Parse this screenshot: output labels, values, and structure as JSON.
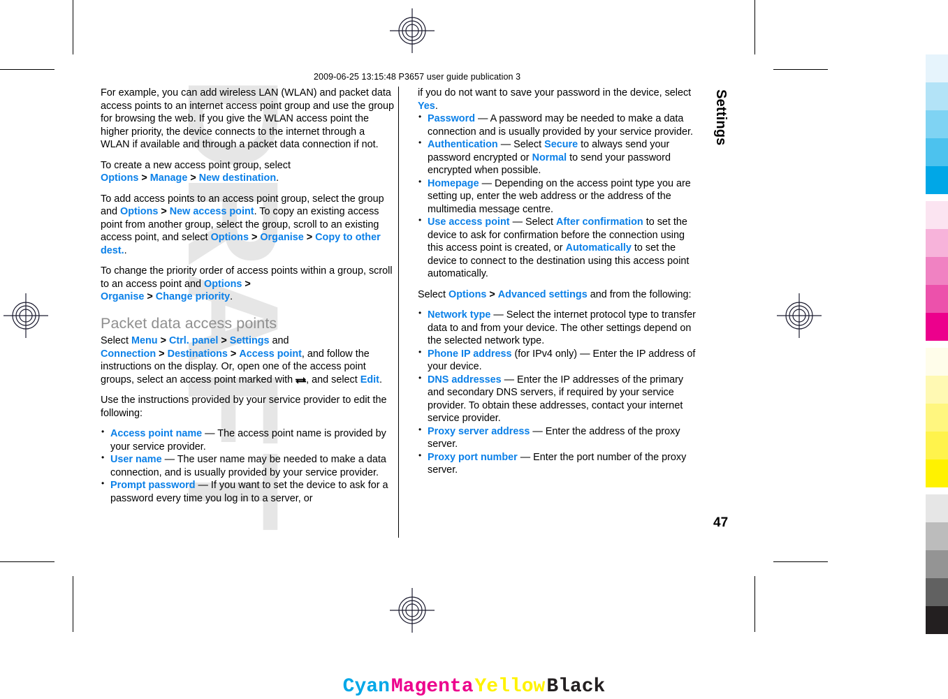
{
  "document": {
    "publication_line": "2009-06-25 13:15:48 P3657 user guide publication 3",
    "watermark": "DRAFT",
    "side_title": "Settings",
    "page_number": "47"
  },
  "left_column": {
    "paragraph_1": {
      "text": "For example, you can add wireless LAN (WLAN) and packet data access points to an internet access point group and use the group for browsing the web. If you give the WLAN access point the higher priority, the device connects to the internet through a WLAN if available and through a packet data connection if not."
    },
    "paragraph_2": {
      "lead": "To create a new access point group, select ",
      "link_1": "Options",
      "sep_1": ">",
      "link_2": "Manage",
      "sep_2": ">",
      "link_3": "New destination",
      "tail": "."
    },
    "paragraph_3": {
      "lead": "To add access points to an access point group, select the group and ",
      "link_1": "Options",
      "sep_1": ">",
      "link_2": "New access point",
      "mid": ". To copy an existing access point from another group, select the group, scroll to an existing access point, and select ",
      "link_3": "Options",
      "sep_2": ">",
      "link_4": "Organise",
      "sep_3": ">",
      "link_5": "Copy to other dest.",
      "tail": "."
    },
    "paragraph_4": {
      "lead": "To change the priority order of access points within a group, scroll to an access point and ",
      "link_1": "Options",
      "sep_1": ">",
      "link_2": "Organise",
      "sep_2": ">",
      "link_3": "Change priority",
      "tail": "."
    },
    "heading": "Packet data access points",
    "paragraph_5": {
      "lead": "Select ",
      "link_1": "Menu",
      "sep_1": ">",
      "link_2": "Ctrl. panel",
      "sep_2": ">",
      "link_3": "Settings",
      "mid_1": " and ",
      "link_4": "Connection",
      "sep_3": ">",
      "link_5": "Destinations",
      "sep_4": ">",
      "link_6": "Access point",
      "mid_2": ", and follow the instructions on the display. Or, open one of the access point groups, select an access point marked with ",
      "icon": "two-way-arrow-icon",
      "mid_3": ", and select ",
      "link_7": "Edit",
      "tail": "."
    },
    "paragraph_6": {
      "text": "Use the instructions provided by your service provider to edit the following:"
    },
    "bullets": [
      {
        "term": "Access point name",
        "desc": " — The access point name is provided by your service provider."
      },
      {
        "term": "User name",
        "desc": " — The user name may be needed to make a data connection, and is usually provided by your service provider."
      },
      {
        "term": "Prompt password",
        "desc": " — If you want to set the device to ask for a password every time you log in to a server, or"
      }
    ]
  },
  "right_column": {
    "continued_text": {
      "lead": "if you do not want to save your password in the device, select ",
      "link_1": "Yes",
      "tail": "."
    },
    "bullets_1": [
      {
        "term": "Password",
        "desc": " — A password may be needed to make a data connection and is usually provided by your service provider."
      },
      {
        "term": "Authentication",
        "desc_pre": " — Select ",
        "link_a": "Secure",
        "desc_mid": " to always send your password encrypted or ",
        "link_b": "Normal",
        "desc_post": " to send your password encrypted when possible."
      },
      {
        "term": "Homepage",
        "desc": " — Depending on the access point type you are setting up, enter the web address or the address of the multimedia message centre."
      },
      {
        "term": "Use access point",
        "desc_pre": " — Select ",
        "link_a": "After confirmation",
        "desc_mid": " to set the device to ask for confirmation before the connection using this access point is created, or ",
        "link_b": "Automatically",
        "desc_post": " to set the device to connect to the destination using this access point automatically."
      }
    ],
    "paragraph_select": {
      "lead": "Select ",
      "link_1": "Options",
      "sep_1": ">",
      "link_2": "Advanced settings",
      "tail": " and from the following:"
    },
    "bullets_2": [
      {
        "term": "Network type",
        "desc": " — Select the internet protocol type to transfer data to and from your device. The other settings depend on the selected network type."
      },
      {
        "term": "Phone IP address",
        "desc": " (for IPv4 only) — Enter the IP address of your device."
      },
      {
        "term": "DNS addresses",
        "desc": " — Enter the IP addresses of the primary and secondary DNS servers, if required by your service provider. To obtain these addresses, contact your internet service provider."
      },
      {
        "term": "Proxy server address",
        "desc": " — Enter the address of the proxy server."
      },
      {
        "term": "Proxy port number",
        "desc": " — Enter the port number of the proxy server."
      }
    ]
  },
  "colors": {
    "link_blue": "#0b80e8",
    "heading_gray": "#8f8f8f",
    "watermark_gray": "#e6e6e6",
    "cyan": "#00a7e7",
    "magenta": "#ec008c",
    "yellow": "#fff200",
    "black": "#231f20"
  },
  "calibration": {
    "cyan_strip": [
      "#e6f4fc",
      "#b3e3f7",
      "#7fd3f3",
      "#4cc2ee",
      "#00a7e7"
    ],
    "magenta_strip": [
      "#fbe4f1",
      "#f7b3da",
      "#f082c2",
      "#ec51ab",
      "#ec008c"
    ],
    "yellow_strip": [
      "#fffdea",
      "#fff9b3",
      "#fff67f",
      "#fff34c",
      "#fff200"
    ],
    "black_strip": [
      "#e6e6e6",
      "#bcbcbc",
      "#949494",
      "#616161",
      "#231f20"
    ]
  },
  "cmyk_footer": [
    {
      "label": "Cyan",
      "color": "#00a7e7"
    },
    {
      "label": "Magenta",
      "color": "#ec008c"
    },
    {
      "label": "Yellow",
      "color": "#fff200"
    },
    {
      "label": "Black",
      "color": "#231f20"
    }
  ]
}
